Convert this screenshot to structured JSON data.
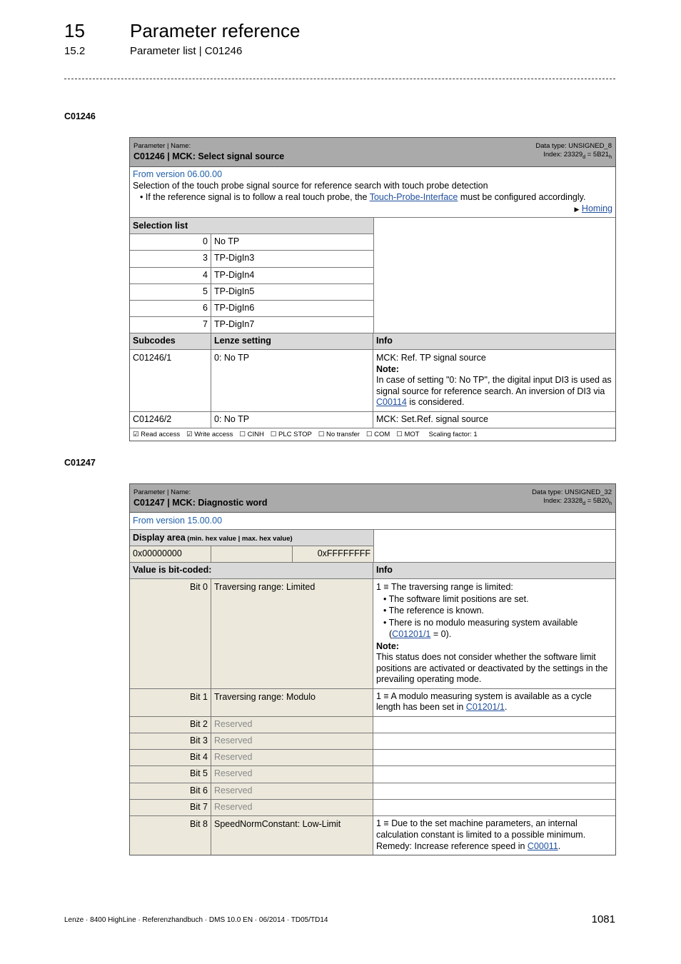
{
  "header": {
    "chapter_number": "15",
    "chapter_title": "Parameter reference",
    "section_number": "15.2",
    "section_title": "Parameter list | C01246"
  },
  "params": [
    {
      "code_heading": "C01246",
      "label": "Parameter | Name:",
      "name": "C01246 | MCK: Select signal source",
      "data_type": "Data type: UNSIGNED_8",
      "index_prefix": "Index: 23329",
      "index_sub_d": "d",
      "index_mid": " = 5B21",
      "index_sub_h": "h",
      "version": "From version 06.00.00",
      "description": "Selection of the touch probe signal source for reference search with touch probe detection",
      "bullet_pre": "If the reference signal is to follow a real touch probe, the ",
      "bullet_link": "Touch-Probe-Interface",
      "bullet_post": " must be configured accordingly.",
      "see_also_link": "Homing",
      "selection_header": "Selection list",
      "selection": [
        {
          "value": "0",
          "label": "No TP"
        },
        {
          "value": "3",
          "label": "TP-DigIn3"
        },
        {
          "value": "4",
          "label": "TP-DigIn4"
        },
        {
          "value": "5",
          "label": "TP-DigIn5"
        },
        {
          "value": "6",
          "label": "TP-DigIn6"
        },
        {
          "value": "7",
          "label": "TP-DigIn7"
        }
      ],
      "sub_headers": [
        "Subcodes",
        "Lenze setting",
        "Info"
      ],
      "subcodes": [
        {
          "code": "C01246/1",
          "setting": "0: No TP",
          "info": "MCK: Ref. TP signal source",
          "note_label": "Note:",
          "note_pre": "In case of setting \"0: No TP\", the digital input DI3 is used as signal source for reference search. An inversion of DI3 via ",
          "note_link": "C00114",
          "note_post": " is considered."
        },
        {
          "code": "C01246/2",
          "setting": "0: No TP",
          "info": "MCK: Set.Ref. signal source"
        }
      ],
      "flags": [
        "☑ Read access",
        "☑ Write access",
        "☐ CINH",
        "☐ PLC STOP",
        "☐ No transfer",
        "☐ COM",
        "☐ MOT",
        "Scaling factor: 1"
      ]
    },
    {
      "code_heading": "C01247",
      "label": "Parameter | Name:",
      "name": "C01247 | MCK: Diagnostic word",
      "data_type": "Data type: UNSIGNED_32",
      "index_prefix": "Index: 23328",
      "index_sub_d": "d",
      "index_mid": " = 5B20",
      "index_sub_h": "h",
      "version": "From version 15.00.00",
      "display_area_label": "Display area",
      "display_area_hint": " (min. hex value | max. hex value)",
      "min_hex": "0x00000000",
      "max_hex": "0xFFFFFFFF",
      "bits_header": "Value is bit-coded:",
      "info_header": "Info",
      "bits": [
        {
          "bit": "Bit 0",
          "name": "Traversing range: Limited",
          "info_main": "1 ≡ The traversing range is limited:",
          "bullets": [
            "The software limit positions are set.",
            "The reference is known.",
            "There is no modulo measuring system available"
          ],
          "bullet_cont_pre": "(",
          "bullet_cont_link": "C01201/1",
          "bullet_cont_post": " = 0).",
          "note_label": "Note:",
          "note": "This status does not consider whether the software limit positions are activated or deactivated by the settings in the prevailing operating mode."
        },
        {
          "bit": "Bit 1",
          "name": "Traversing range: Modulo",
          "info_pre": "1 ≡ A modulo measuring system is available as a cycle length has been set in ",
          "info_link": "C01201/1",
          "info_post": "."
        },
        {
          "bit": "Bit 2",
          "name": "Reserved"
        },
        {
          "bit": "Bit 3",
          "name": "Reserved"
        },
        {
          "bit": "Bit 4",
          "name": "Reserved"
        },
        {
          "bit": "Bit 5",
          "name": "Reserved"
        },
        {
          "bit": "Bit 6",
          "name": "Reserved"
        },
        {
          "bit": "Bit 7",
          "name": "Reserved"
        },
        {
          "bit": "Bit 8",
          "name": "SpeedNormConstant: Low-Limit",
          "info_pre": "1 ≡ Due to the set machine parameters, an internal calculation constant is limited to a possible minimum.",
          "remedy_pre": "Remedy: Increase reference speed in ",
          "remedy_link": "C00011",
          "remedy_post": "."
        }
      ]
    }
  ],
  "footer": {
    "text": "Lenze · 8400 HighLine · Referenzhandbuch · DMS 10.0 EN · 06/2014 · TD05/TD14",
    "page_number": "1081"
  }
}
